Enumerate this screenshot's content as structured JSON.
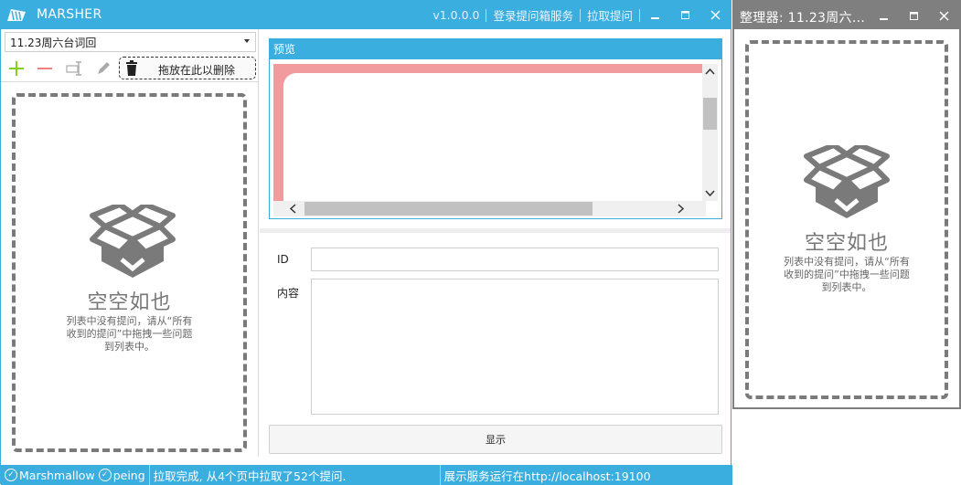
{
  "main_window": {
    "title": "MARSHER",
    "version": "v1.0.0.0",
    "links": [
      "登录提问箱服务",
      "拉取提问"
    ],
    "controls": {
      "minimize": "🗕",
      "maximize": "🗖",
      "close": "✕"
    }
  },
  "left_panel": {
    "selected_list": "11.23周六台词回",
    "toolbar": {
      "add_icon": "plus-icon",
      "remove_icon": "minus-icon",
      "rename_icon": "rename-icon",
      "edit_icon": "pencil-icon",
      "trash_icon": "trash-icon",
      "drop_delete_label": "拖放在此以删除"
    },
    "empty_state": {
      "title": "空空如也",
      "line1": "列表中没有提问，请从“所有",
      "line2": "收到的提问”中拖拽一些问题",
      "line3": "到列表中。"
    }
  },
  "preview": {
    "header": "预览"
  },
  "form": {
    "id_label": "ID",
    "id_value": "",
    "content_label": "内容",
    "content_value": "",
    "show_button": "显示"
  },
  "statusbar": {
    "account1": "Marshmallow",
    "account2": "peing",
    "message": "拉取完成, 从4个页中拉取了52个提问.",
    "server": "展示服务运行在http://localhost:19100"
  },
  "organizer_window": {
    "title": "整理器: 11.23周六...",
    "empty_state": {
      "title": "空空如也",
      "line1": "列表中没有提问，请从“所有",
      "line2": "收到的提问”中拖拽一些问题",
      "line3": "到列表中。"
    }
  },
  "colors": {
    "accent": "#3baee0",
    "organizer_title": "#7f7f7f",
    "preview_bg": "#f29b9e",
    "add_green": "#7ed321",
    "remove_red": "#f08080"
  }
}
